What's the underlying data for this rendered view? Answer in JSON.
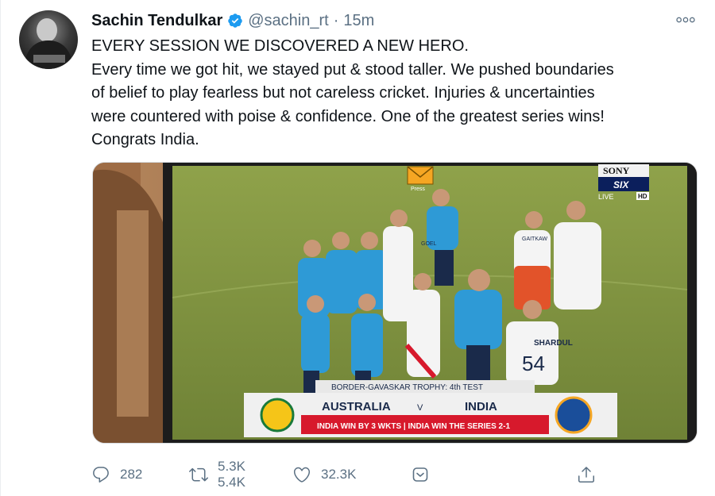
{
  "tweet": {
    "author_name": "Sachin Tendulkar",
    "handle": "@sachin_rt",
    "separator": "·",
    "time": "15m",
    "text_lines": [
      "EVERY SESSION WE DISCOVERED A NEW HERO.",
      "Every time we got hit, we stayed put & stood taller. We pushed boundaries",
      "of belief to play fearless but not careless cricket. Injuries & uncertainties",
      "were countered with poise & confidence. One of the greatest series wins!",
      "Congrats India."
    ]
  },
  "media": {
    "broadcaster": "SONY",
    "channel": "SIX",
    "live": "LIVE",
    "hd": "HD",
    "press_label": "Press",
    "scorebar": {
      "title": "BORDER-GAVASKAR TROPHY: 4th TEST",
      "team_left": "AUSTRALIA",
      "versus": "V",
      "team_right": "INDIA",
      "result": "INDIA WIN BY 3 WKTS | INDIA WIN THE SERIES 2-1"
    },
    "jerseys": [
      {
        "name": "SHARDUL",
        "number": "54"
      },
      {
        "name": "GAITKAW",
        "number": ""
      },
      {
        "name": "GOEL",
        "number": ""
      }
    ],
    "colors": {
      "pitch": "#7a8b3c",
      "india_blue": "#2e9ad6",
      "result_red": "#d7192c",
      "frame_wood": "#6b4a33"
    }
  },
  "actions": {
    "reply_count": "282",
    "retweet_count": "5.3K",
    "retweet_count_next": "5.4K",
    "like_count": "32.3K",
    "colors": {
      "icon": "#5b7083"
    }
  },
  "icons": [
    "verified-badge-icon",
    "more-options-icon",
    "reply-icon",
    "retweet-icon",
    "like-icon",
    "save-icon",
    "share-icon"
  ]
}
